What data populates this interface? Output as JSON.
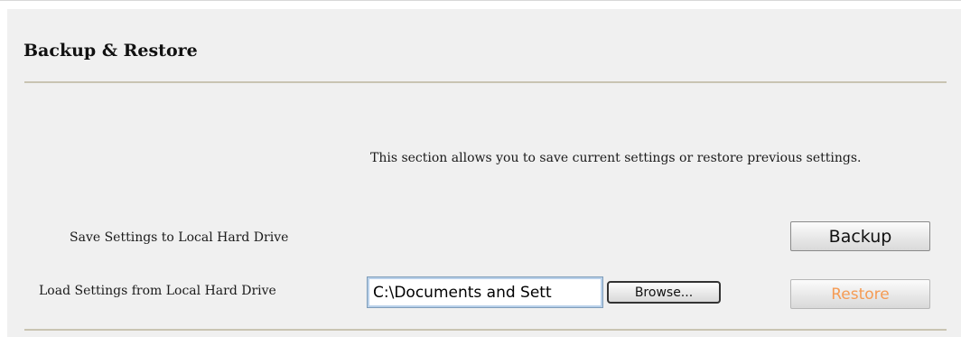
{
  "section": {
    "title": "Backup & Restore",
    "description": "This section allows you to save current settings or restore previous settings."
  },
  "rows": {
    "save": {
      "label": "Save Settings to Local Hard Drive",
      "button_label": "Backup"
    },
    "load": {
      "label": "Load Settings from Local Hard Drive",
      "file_value": "C:\\Documents and Sett",
      "browse_label": "Browse...",
      "button_label": "Restore"
    }
  },
  "colors": {
    "panel_background": "#f0f0f0",
    "divider": "#c9c4b2",
    "restore_text": "#f59b54"
  }
}
